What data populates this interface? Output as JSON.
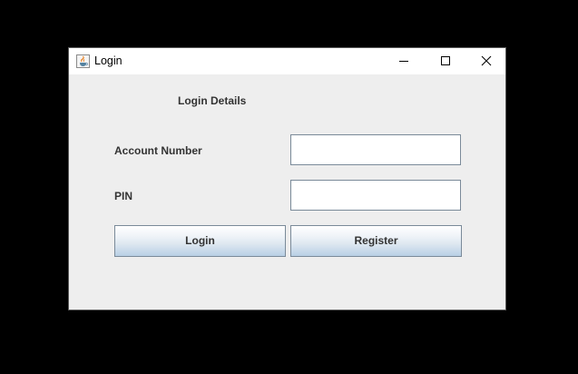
{
  "window": {
    "title": "Login",
    "app_icon": "java-cup-icon",
    "controls": [
      "minimize-icon",
      "maximize-icon",
      "close-icon"
    ]
  },
  "form": {
    "heading": "Login Details",
    "account_label": "Account Number",
    "account_value": "",
    "pin_label": "PIN",
    "pin_value": ""
  },
  "buttons": {
    "login_label": "Login",
    "register_label": "Register"
  },
  "colors": {
    "background": "#000000",
    "window_bg": "#eeeeee",
    "titlebar_bg": "#ffffff",
    "button_gradient_bottom": "#b8cfe5",
    "border": "#7a8a99"
  }
}
